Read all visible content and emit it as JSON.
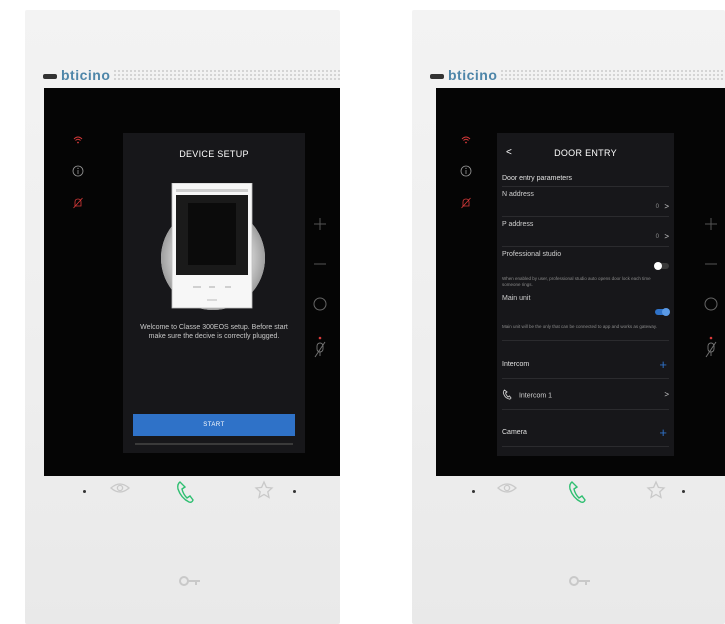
{
  "brand": "bticino",
  "icons": {
    "wifi": "wifi-icon",
    "info": "info-icon",
    "mute": "muted-bell-icon",
    "plus": "plus-icon",
    "minus": "minus-icon",
    "circle": "circle-button-icon",
    "mic": "mic-off-icon",
    "eye": "eye-icon",
    "phone": "phone-icon",
    "star": "star-icon",
    "key": "key-icon"
  },
  "colors": {
    "accent": "#2f72c8",
    "alert": "#d93a3a",
    "phone": "#2fbf71",
    "logo": "#4e86a9"
  },
  "setup": {
    "title": "DEVICE SETUP",
    "welcome": "Welcome to Classe 300EOS setup. Before start make sure the decive is correctly plugged.",
    "start_label": "START"
  },
  "door_entry": {
    "back_label": "<",
    "title": "DOOR ENTRY",
    "section_label": "Door entry parameters",
    "n_address": {
      "label": "N address",
      "value": "0"
    },
    "p_address": {
      "label": "P address",
      "value": "0"
    },
    "professional_studio": {
      "label": "Professional studio",
      "enabled": false,
      "note": "When enabled by user, professional studio auto opens door lock each time someone rings."
    },
    "main_unit": {
      "label": "Main unit",
      "enabled": true,
      "note": "Main unit will be the only that can be connected to app and works as gateway."
    },
    "intercom_label": "Intercom",
    "intercom_item": "Intercom 1",
    "camera_label": "Camera"
  }
}
